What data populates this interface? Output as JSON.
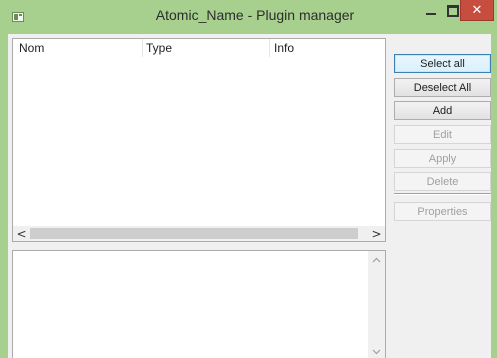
{
  "window": {
    "title": "Atomic_Name - Plugin manager",
    "close_glyph": "✕",
    "accent_color": "#a7d08f",
    "close_color": "#c74e3f"
  },
  "table": {
    "columns": [
      "Nom",
      "Type",
      "Info"
    ],
    "rows": []
  },
  "scroll": {
    "left_glyph": "<",
    "right_glyph": ">",
    "up_glyph": "^",
    "down_glyph": "v"
  },
  "buttons": {
    "select_all": "Select all",
    "deselect_all": "Deselect All",
    "add": "Add",
    "edit": "Edit",
    "apply": "Apply",
    "delete": "Delete",
    "properties": "Properties"
  },
  "log": {
    "text": ""
  }
}
